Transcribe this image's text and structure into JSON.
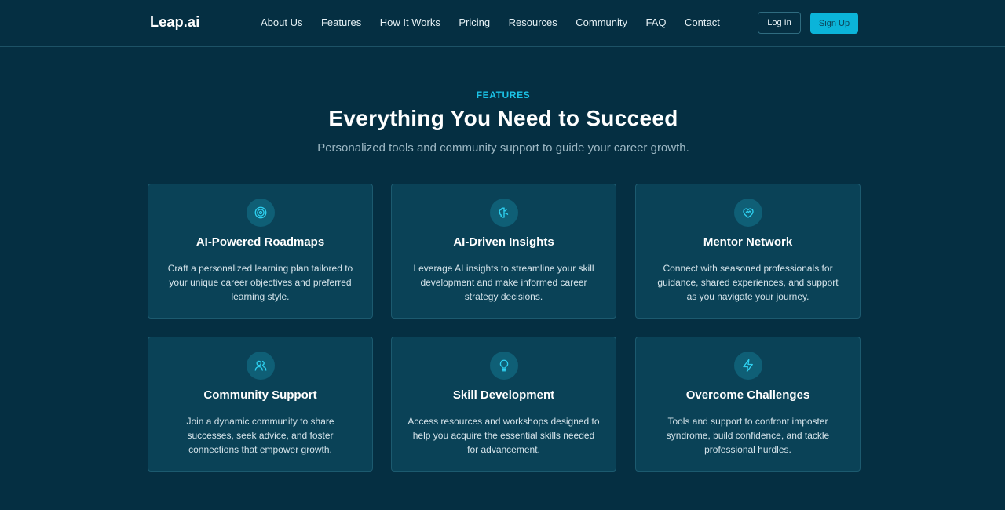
{
  "header": {
    "logo": "Leap.ai",
    "nav": [
      "About Us",
      "Features",
      "How It Works",
      "Pricing",
      "Resources",
      "Community",
      "FAQ",
      "Contact"
    ],
    "login_label": "Log In",
    "signup_label": "Sign Up"
  },
  "section": {
    "eyebrow": "FEATURES",
    "title": "Everything You Need to Succeed",
    "subtitle": "Personalized tools and community support to guide your career growth."
  },
  "features": [
    {
      "icon": "target-icon",
      "title": "AI-Powered Roadmaps",
      "desc": "Craft a personalized learning plan tailored to your unique career objectives and preferred learning style."
    },
    {
      "icon": "brain-icon",
      "title": "AI-Driven Insights",
      "desc": "Leverage AI insights to streamline your skill development and make informed career strategy decisions."
    },
    {
      "icon": "heart-handshake-icon",
      "title": "Mentor Network",
      "desc": "Connect with seasoned professionals for guidance, shared experiences, and support as you navigate your journey."
    },
    {
      "icon": "users-icon",
      "title": "Community Support",
      "desc": "Join a dynamic community to share successes, seek advice, and foster connections that empower growth."
    },
    {
      "icon": "lightbulb-icon",
      "title": "Skill Development",
      "desc": "Access resources and workshops designed to help you acquire the essential skills needed for advancement."
    },
    {
      "icon": "zap-icon",
      "title": "Overcome Challenges",
      "desc": "Tools and support to confront imposter syndrome, build confidence, and tackle professional hurdles."
    }
  ],
  "colors": {
    "background": "#052f42",
    "accent": "#1bc2e6",
    "card": "#0a4257"
  }
}
